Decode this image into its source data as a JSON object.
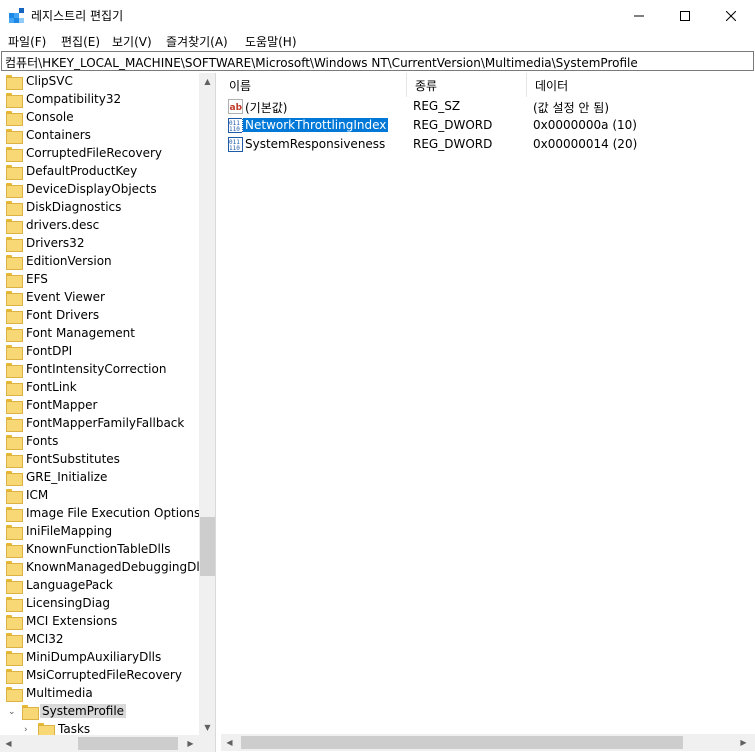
{
  "window": {
    "title": "레지스트리 편집기",
    "min_glyph": "—",
    "max_glyph": "☐",
    "close_glyph": "✕"
  },
  "menu": [
    "파일(F)",
    "편집(E)",
    "보기(V)",
    "즐겨찾기(A)",
    "도움말(H)"
  ],
  "address": "컴퓨터\\HKEY_LOCAL_MACHINE\\SOFTWARE\\Microsoft\\Windows NT\\CurrentVersion\\Multimedia\\SystemProfile",
  "tree": {
    "items": [
      "ClipSVC",
      "Compatibility32",
      "Console",
      "Containers",
      "CorruptedFileRecovery",
      "DefaultProductKey",
      "DeviceDisplayObjects",
      "DiskDiagnostics",
      "drivers.desc",
      "Drivers32",
      "EditionVersion",
      "EFS",
      "Event Viewer",
      "Font Drivers",
      "Font Management",
      "FontDPI",
      "FontIntensityCorrection",
      "FontLink",
      "FontMapper",
      "FontMapperFamilyFallback",
      "Fonts",
      "FontSubstitutes",
      "GRE_Initialize",
      "ICM",
      "Image File Execution Options",
      "IniFileMapping",
      "KnownFunctionTableDlls",
      "KnownManagedDebuggingDlls",
      "LanguagePack",
      "LicensingDiag",
      "MCI Extensions",
      "MCI32",
      "MiniDumpAuxiliaryDlls",
      "MsiCorruptedFileRecovery",
      "Multimedia"
    ],
    "selected": "SystemProfile",
    "selected_expander": "⌄",
    "child": "Tasks",
    "child_expander": "›"
  },
  "list": {
    "columns": [
      "이름",
      "종류",
      "데이터"
    ],
    "rows": [
      {
        "name": "(기본값)",
        "type": "REG_SZ",
        "data": "(값 설정 안 됨)",
        "icon": "string-value-icon"
      },
      {
        "name": "NetworkThrottlingIndex",
        "type": "REG_DWORD",
        "data": "0x0000000a (10)",
        "icon": "binary-value-icon"
      },
      {
        "name": "SystemResponsiveness",
        "type": "REG_DWORD",
        "data": "0x00000014 (20)",
        "icon": "binary-value-icon"
      }
    ]
  },
  "colors": {
    "selection": "#0078d7",
    "folder": "#f8d775",
    "string_icon": "#c0392b",
    "binary_icon": "#1e5aa8"
  }
}
